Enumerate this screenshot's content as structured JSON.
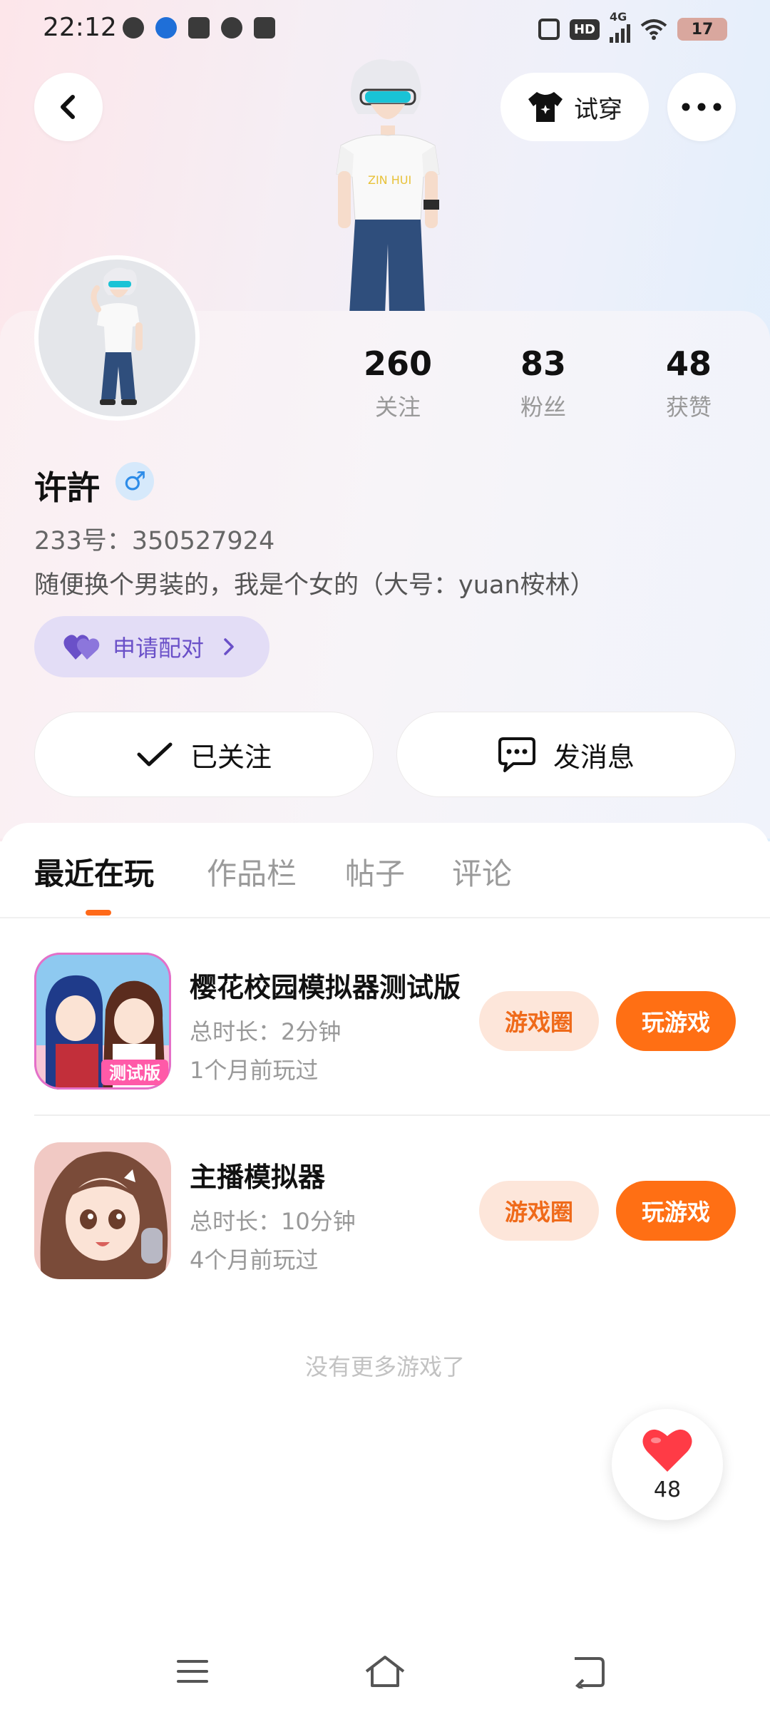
{
  "status_bar": {
    "time": "22:12",
    "network": "4G",
    "hd": "HD",
    "battery": "17"
  },
  "header": {
    "try_on_label": "试穿",
    "icons": [
      "back-icon",
      "tshirt-icon",
      "more-icon"
    ]
  },
  "profile": {
    "nickname": "许許",
    "gender_symbol": "♂",
    "uid": "233号：350527924",
    "bio": "随便换个男装的，我是个女的（大号：yuan桉林）",
    "pair_label": "申请配对",
    "stats": [
      {
        "value": "260",
        "label": "关注"
      },
      {
        "value": "83",
        "label": "粉丝"
      },
      {
        "value": "48",
        "label": "获赞"
      }
    ],
    "follow_label": "已关注",
    "message_label": "发消息"
  },
  "tabs": [
    {
      "label": "最近在玩",
      "active": true
    },
    {
      "label": "作品栏",
      "active": false
    },
    {
      "label": "帖子",
      "active": false
    },
    {
      "label": "评论",
      "active": false
    }
  ],
  "games": [
    {
      "title": "樱花校园模拟器测试版",
      "icon_caption": "测试版",
      "duration": "总时长：2分钟",
      "last_played": "1个月前玩过",
      "circle_label": "游戏圈",
      "play_label": "玩游戏"
    },
    {
      "title": "主播模拟器",
      "duration": "总时长：10分钟",
      "last_played": "4个月前玩过",
      "circle_label": "游戏圈",
      "play_label": "玩游戏"
    }
  ],
  "no_more_text": "没有更多游戏了",
  "like_fab": {
    "count": "48"
  },
  "colors": {
    "accent_orange": "#ff6f14",
    "pair_purple": "#6a50c8",
    "gender_blue": "#2d8ce8"
  }
}
